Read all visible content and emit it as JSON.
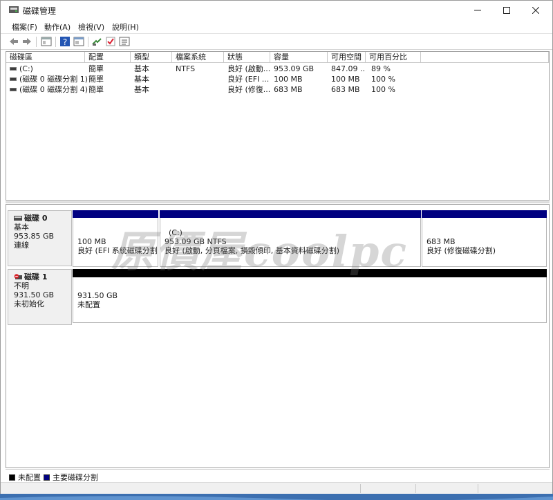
{
  "window": {
    "title": "磁碟管理"
  },
  "menu": [
    "檔案(F)",
    "動作(A)",
    "檢視(V)",
    "說明(H)"
  ],
  "toolbar_icons": [
    "back-icon",
    "forward-icon",
    "console-tree-icon",
    "help-icon",
    "properties-icon",
    "connect-icon",
    "check-icon",
    "list-icon"
  ],
  "volumes": {
    "columns": [
      "磁碟區",
      "配置",
      "類型",
      "檔案系統",
      "狀態",
      "容量",
      "可用空間",
      "可用百分比"
    ],
    "rows": [
      [
        "(C:)",
        "簡單",
        "基本",
        "NTFS",
        "良好 (啟動...",
        "953.09 GB",
        "847.09 ...",
        "89 %"
      ],
      [
        "(磁碟 0 磁碟分割 1)",
        "簡單",
        "基本",
        "",
        "良好 (EFI ...",
        "100 MB",
        "100 MB",
        "100 %"
      ],
      [
        "(磁碟 0 磁碟分割 4)",
        "簡單",
        "基本",
        "",
        "良好 (修復...",
        "683 MB",
        "683 MB",
        "100 %"
      ]
    ]
  },
  "disks": [
    {
      "name": "磁碟 0",
      "type": "基本",
      "size": "953.85 GB",
      "status": "連線",
      "partitions": [
        {
          "title": "",
          "size": "100 MB",
          "status": "良好 (EFI 系統磁碟分割)"
        },
        {
          "title": "(C:)",
          "size": "953.09 GB NTFS",
          "status": "良好 (啟動, 分頁檔案, 損毀傾印, 基本資料磁碟分割)"
        },
        {
          "title": "",
          "size": "683 MB",
          "status": "良好 (修復磁碟分割)"
        }
      ]
    },
    {
      "name": "磁碟 1",
      "type": "不明",
      "size": "931.50 GB",
      "status": "未初始化",
      "partitions": [
        {
          "title": "",
          "size": "931.50 GB",
          "status": "未配置"
        }
      ]
    }
  ],
  "legend": [
    {
      "label": "未配置",
      "color": "#000000"
    },
    {
      "label": "主要磁碟分割",
      "color": "#000080"
    }
  ],
  "colors": {
    "primary_partition": "#000080",
    "unallocated": "#000000",
    "background": "#3c6fb0"
  },
  "watermark": "原價屋coolpc"
}
